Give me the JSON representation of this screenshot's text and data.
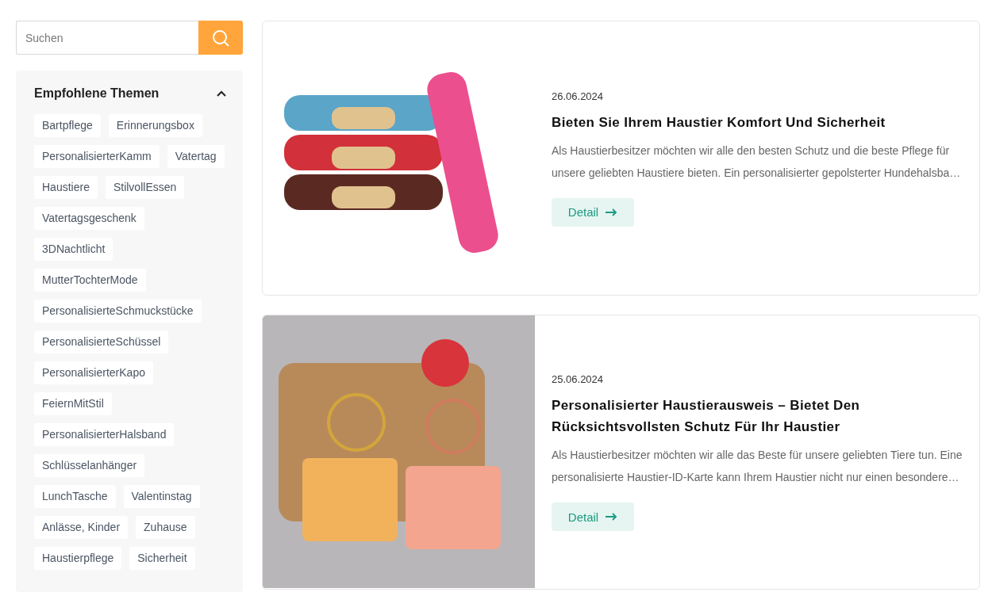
{
  "search": {
    "placeholder": "Suchen"
  },
  "topics": {
    "title": "Empfohlene Themen",
    "expanded": true,
    "tags": [
      "Bartpflege",
      "Erinnerungsbox",
      "PersonalisierterKamm",
      "Vatertag",
      "Haustiere",
      "StilvollEssen",
      "Vatertagsgeschenk",
      "3DNachtlicht",
      "MutterTochterMode",
      "PersonalisierteSchmuckstücke",
      "PersonalisierteSchüssel",
      "PersonalisierterKapo",
      "FeiernMitStil",
      "PersonalisierterHalsband",
      "Schlüsselanhänger",
      "LunchTasche",
      "Valentinstag",
      "Anlässe, Kinder",
      "Zuhause",
      "Haustierpflege",
      "Sicherheit"
    ]
  },
  "articles": [
    {
      "date": "26.06.2024",
      "title": "Bieten Sie Ihrem Haustier Komfort Und Sicherheit",
      "excerpt": "Als Haustierbesitzer möchten wir alle den besten Schutz und die beste Pflege für unsere geliebten Haustiere bieten. Ein personalisierter gepolsterter Hundehalsba…",
      "button": "Detail"
    },
    {
      "date": "25.06.2024",
      "title": "Personalisierter Haustierausweis – Bietet Den Rücksichtsvollsten Schutz Für Ihr Haustier",
      "excerpt": "Als Haustierbesitzer möchten wir alle das Beste für unsere geliebten Tiere tun. Eine personalisierte Haustier-ID-Karte kann Ihrem Haustier nicht nur einen besondere…",
      "button": "Detail"
    }
  ]
}
